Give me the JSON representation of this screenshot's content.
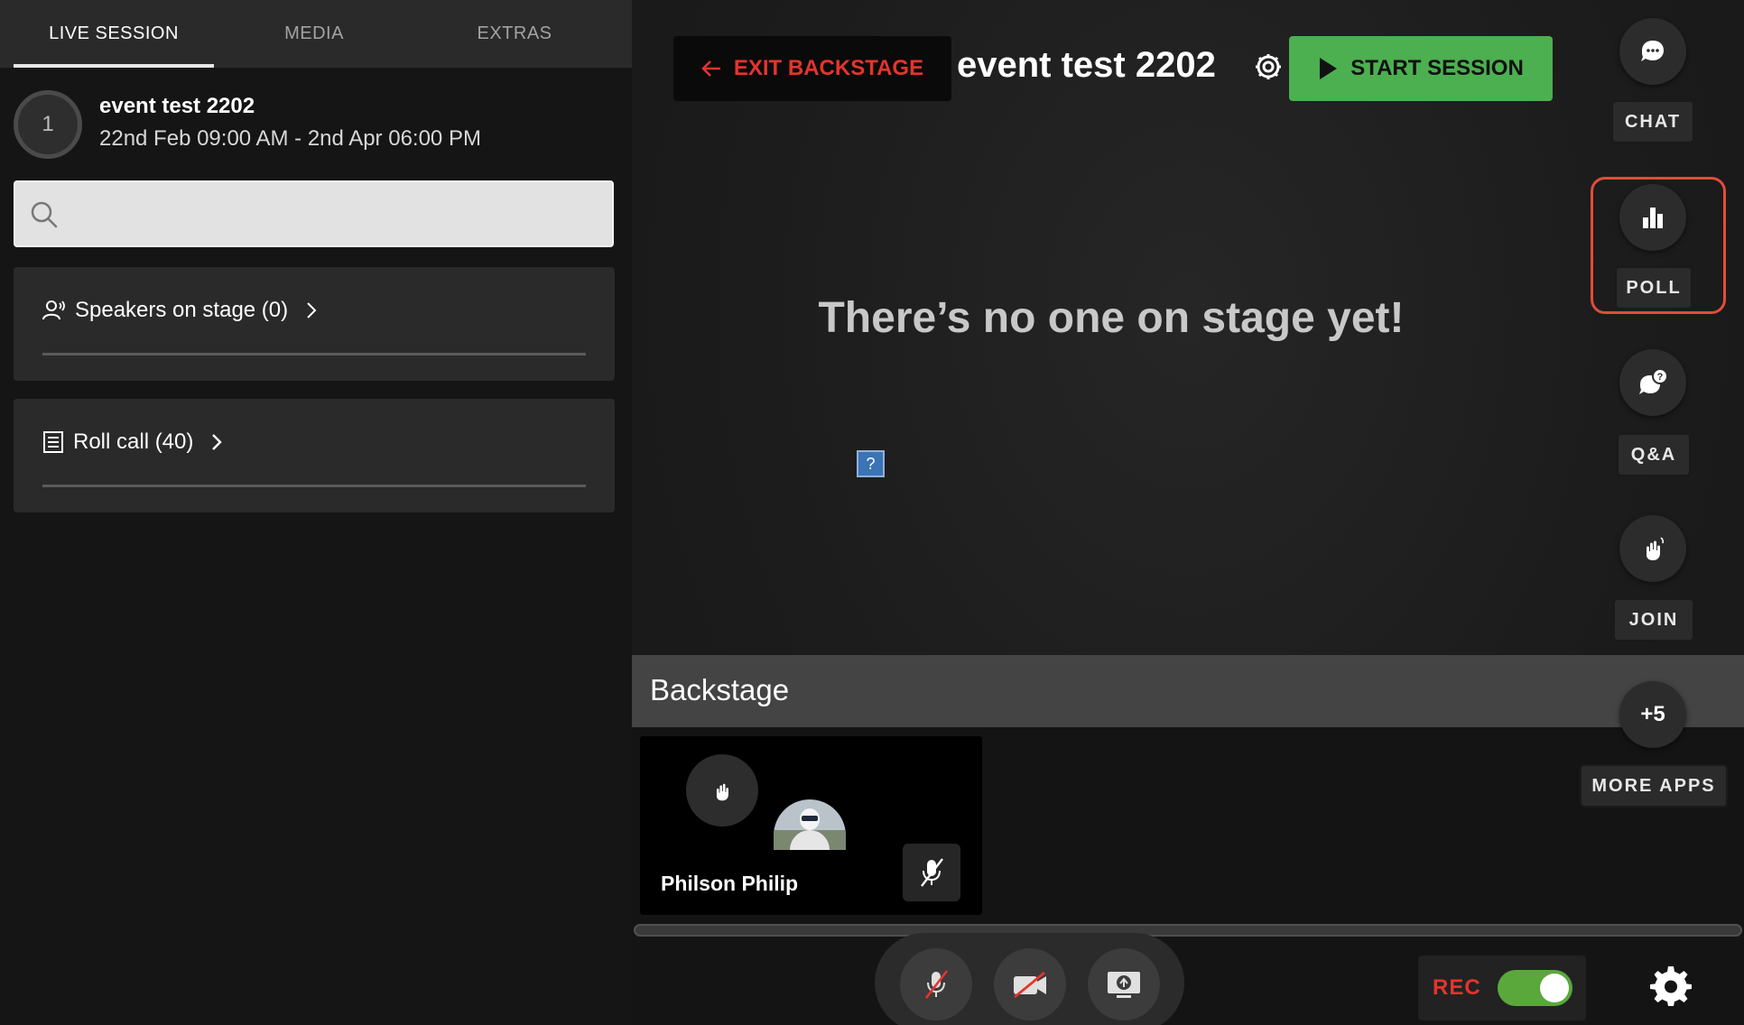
{
  "tabs": [
    {
      "label": "LIVE SESSION"
    },
    {
      "label": "MEDIA"
    },
    {
      "label": "EXTRAS"
    }
  ],
  "event": {
    "badge": "1",
    "title": "event test 2202",
    "dates": "22nd Feb 09:00 AM - 2nd Apr 06:00 PM"
  },
  "search": {
    "placeholder": "",
    "value": ""
  },
  "cards": {
    "speakers": "Speakers on stage (0)",
    "rollcall": "Roll call (40)"
  },
  "stage": {
    "exit_label": "EXIT BACKSTAGE",
    "title": "event test 2202",
    "start_label": "START SESSION",
    "empty_message": "There’s no one on stage yet!",
    "help_glyph": "?"
  },
  "apps": {
    "chat": "CHAT",
    "poll": "POLL",
    "qa": "Q&A",
    "join": "JOIN",
    "more_count": "+5",
    "more": "MORE APPS"
  },
  "backstage": {
    "title": "Backstage",
    "speaker_name": "Philson Philip"
  },
  "controls": {
    "rec_label": "REC",
    "rec_on": true
  },
  "colors": {
    "accent_red": "#e5342c",
    "start_green": "#4caf50",
    "toggle_green": "#5aa83c",
    "highlight": "#e24c3a"
  }
}
